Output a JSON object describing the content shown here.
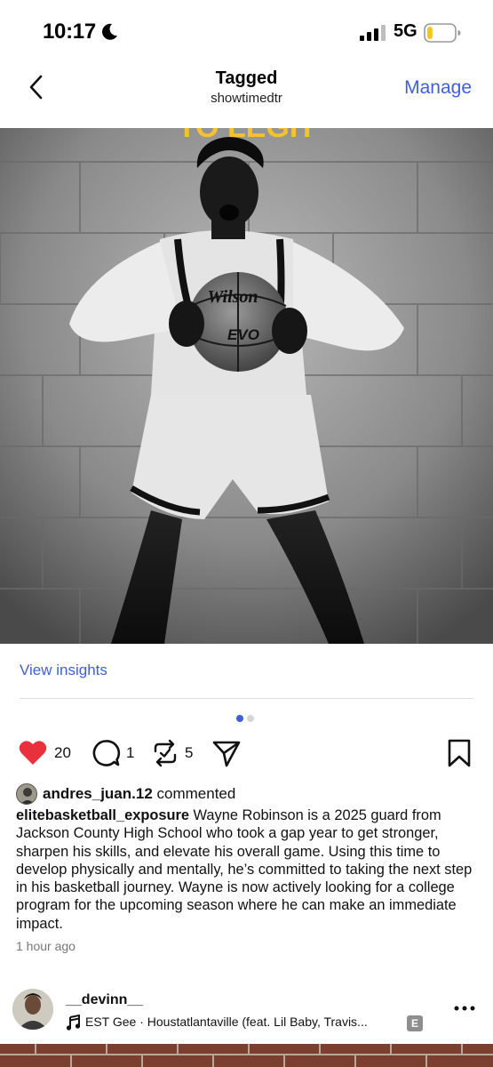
{
  "status_bar": {
    "time": "10:17",
    "network": "5G",
    "battery_level": 0.2,
    "battery_color": "#f5c518"
  },
  "nav": {
    "title": "Tagged",
    "subtitle": "showtimedtr",
    "manage_label": "Manage",
    "back_icon": "chevron-left-icon",
    "accent_color": "#3f5ed8"
  },
  "post": {
    "image_overlay_text": "TO LEGIT",
    "ball_brand": "Wilson",
    "ball_model": "EVO",
    "insights_label": "View insights",
    "carousel": {
      "count": 2,
      "active": 1
    },
    "actions": {
      "likes": "20",
      "comments": "1",
      "reposts": "5",
      "like_icon": "heart-filled-icon",
      "comment_icon": "comment-bubble-icon",
      "repost_icon": "repost-icon",
      "share_icon": "send-icon",
      "save_icon": "bookmark-icon",
      "like_color": "#e8313d"
    },
    "commenter": {
      "username": "andres_juan.12",
      "action": "commented"
    },
    "caption": {
      "username": "elitebasketball_exposure",
      "text": "Wayne Robinson is a 2025 guard from Jackson County High School who took a gap year to get stronger, sharpen his skills, and elevate his overall game. Using this time to develop physically and mentally, he’s committed to taking the next step in his basketball journey. Wayne is now actively looking for a college program for the upcoming season where he can make an immediate impact."
    },
    "timestamp": "1 hour ago"
  },
  "next_post": {
    "username": "__devinn__",
    "song": "EST Gee · Houstatlantaville (feat. Lil Baby, Travis...",
    "explicit_badge": "E",
    "music_icon": "music-note-icon",
    "more_icon": "more-dots-icon"
  }
}
